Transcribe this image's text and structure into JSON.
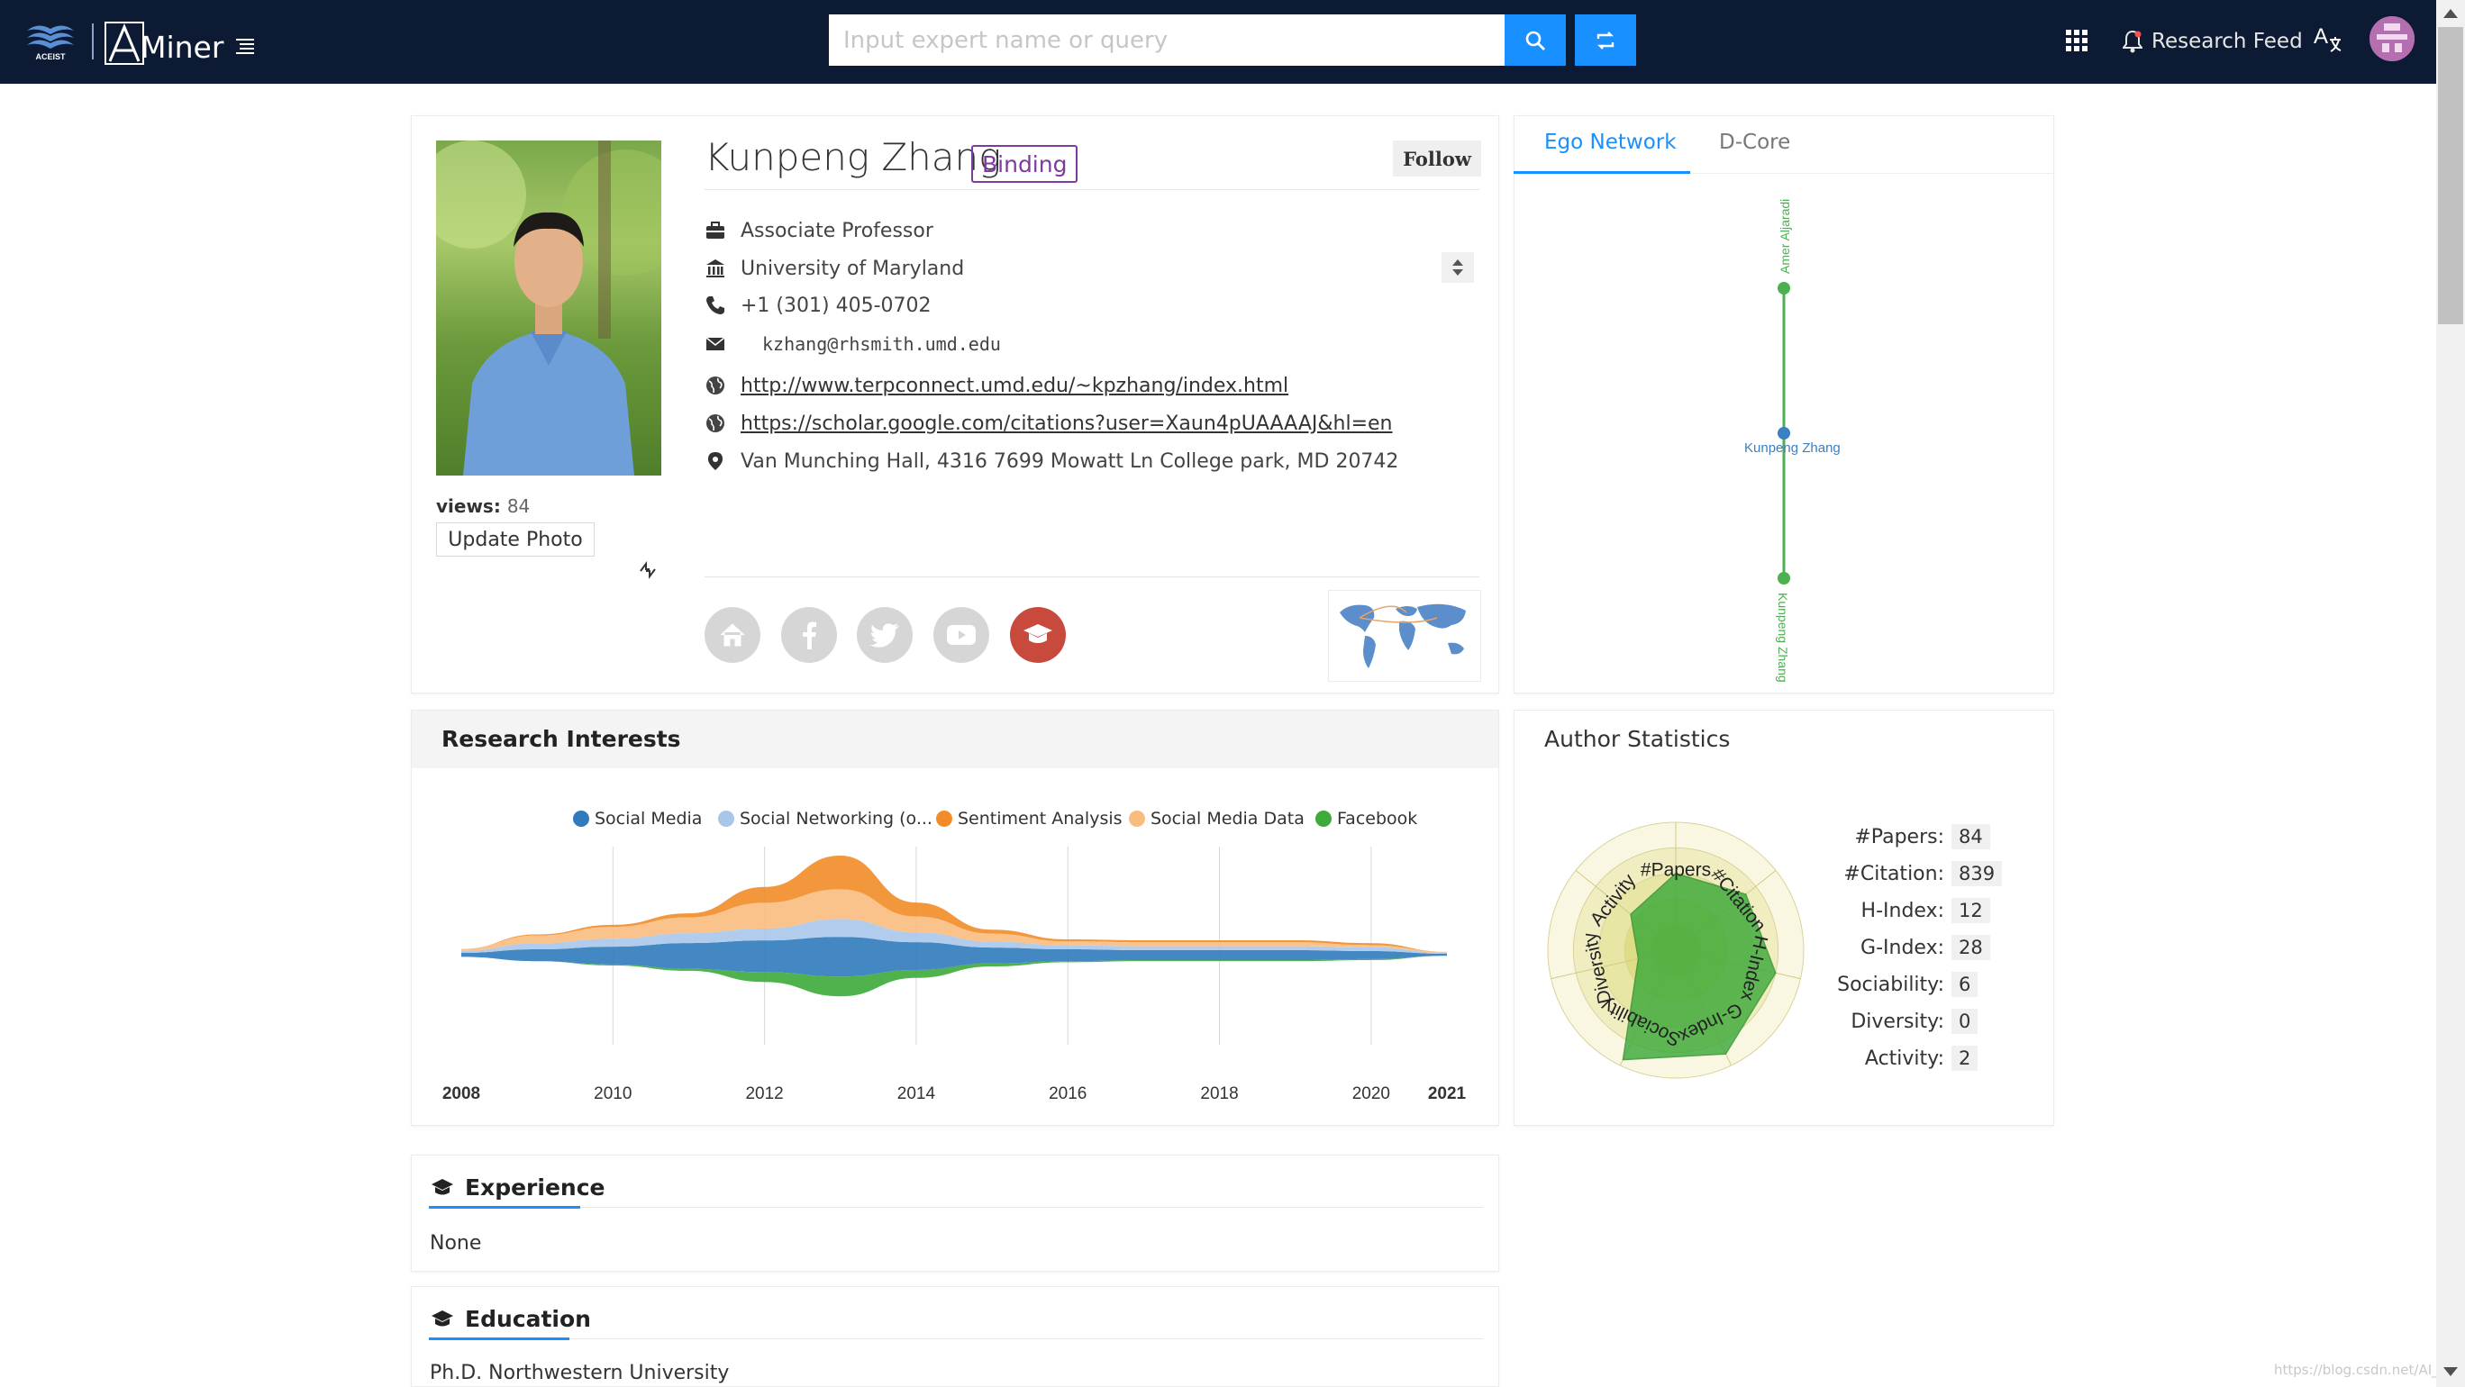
{
  "header": {
    "aminer_logo_text": "Miner",
    "aceist_logo_text": "ACEIST",
    "search_placeholder": "Input expert name or query",
    "research_feed_label": "Research Feed",
    "icons": [
      "menu-icon",
      "search-icon",
      "swap-icon",
      "apps-grid-icon",
      "bell-icon",
      "translate-icon",
      "user-avatar"
    ]
  },
  "profile": {
    "name": "Kunpeng Zhang",
    "binding_label": "Binding",
    "follow_label": "Follow",
    "views_label": "views:",
    "views_count": "84",
    "update_photo_label": "Update Photo",
    "position": "Associate Professor",
    "affiliation": "University of Maryland",
    "phone": "+1 (301) 405-0702",
    "email": "kzhang@rhsmith.umd.edu",
    "homepage": "http://www.terpconnect.umd.edu/~kpzhang/index.html",
    "scholar": "https://scholar.google.com/citations?user=Xaun4pUAAAAJ&hl=en",
    "address": "Van Munching Hall, 4316  7699 Mowatt Ln College park, MD 20742",
    "social_links": [
      "home",
      "facebook",
      "twitter",
      "youtube",
      "graduation-cap"
    ]
  },
  "ego_network": {
    "tabs": [
      "Ego Network",
      "D-Core"
    ],
    "active_tab": "Ego Network",
    "nodes": [
      "Amer Aljaradi",
      "Kunpeng Zhang",
      "Kunpeng Zhang"
    ],
    "colors": {
      "center": "#3b7fc4",
      "peer": "#4caf50"
    }
  },
  "research_interests": {
    "title": "Research Interests",
    "legend": [
      {
        "label": "Social Media",
        "color": "#2f7bbd"
      },
      {
        "label": "Social Networking (o...",
        "color": "#a9c6ea"
      },
      {
        "label": "Sentiment Analysis",
        "color": "#f28c28"
      },
      {
        "label": "Social Media Data",
        "color": "#f8bd7e"
      },
      {
        "label": "Facebook",
        "color": "#3daa3a"
      }
    ]
  },
  "chart_data": {
    "type": "area",
    "x": [
      2008,
      2009,
      2010,
      2011,
      2012,
      2013,
      2014,
      2015,
      2016,
      2017,
      2018,
      2019,
      2020,
      2021
    ],
    "tick_labels": [
      "2008",
      "2010",
      "2012",
      "2014",
      "2016",
      "2018",
      "2020",
      "2021"
    ],
    "series": [
      {
        "name": "Social Media",
        "values": [
          0.2,
          0.6,
          0.9,
          1.3,
          1.6,
          2.0,
          1.4,
          0.8,
          0.6,
          0.5,
          0.5,
          0.5,
          0.4,
          0.1
        ]
      },
      {
        "name": "Social Networking (o...",
        "values": [
          0.1,
          0.3,
          0.4,
          0.5,
          0.6,
          0.9,
          0.5,
          0.3,
          0.2,
          0.2,
          0.2,
          0.2,
          0.2,
          0.05
        ]
      },
      {
        "name": "Sentiment Analysis",
        "values": [
          0,
          0.05,
          0.1,
          0.2,
          0.8,
          1.7,
          0.7,
          0.2,
          0.1,
          0.1,
          0.1,
          0.1,
          0.1,
          0
        ]
      },
      {
        "name": "Social Media Data",
        "values": [
          0.1,
          0.4,
          0.6,
          0.8,
          1.3,
          1.5,
          0.8,
          0.4,
          0.2,
          0.2,
          0.2,
          0.2,
          0.1,
          0.05
        ]
      },
      {
        "name": "Facebook",
        "values": [
          0,
          0,
          0.05,
          0.1,
          0.5,
          1.0,
          0.4,
          0.15,
          0.05,
          0.05,
          0.05,
          0.05,
          0.05,
          0
        ]
      }
    ],
    "grid": true,
    "legend_position": "top"
  },
  "author_statistics": {
    "title": "Author Statistics",
    "radar_axes": [
      "#Papers",
      "#Citation",
      "H-Index",
      "G-Index",
      "Sociability",
      "Diversity",
      "Activity"
    ],
    "stats": [
      {
        "label": "#Papers:",
        "value": "84"
      },
      {
        "label": "#Citation:",
        "value": "839"
      },
      {
        "label": "H-Index:",
        "value": "12"
      },
      {
        "label": "G-Index:",
        "value": "28"
      },
      {
        "label": "Sociability:",
        "value": "6"
      },
      {
        "label": "Diversity:",
        "value": "0"
      },
      {
        "label": "Activity:",
        "value": "2"
      }
    ],
    "radar_levels": [
      0.6,
      0.7,
      0.8,
      0.9,
      0.95,
      0.3,
      0.45
    ]
  },
  "experience": {
    "title": "Experience",
    "text": "None"
  },
  "education": {
    "title": "Education",
    "text": "Ph.D. Northwestern University"
  },
  "watermark": "https://blog.csdn.net/AI_C"
}
